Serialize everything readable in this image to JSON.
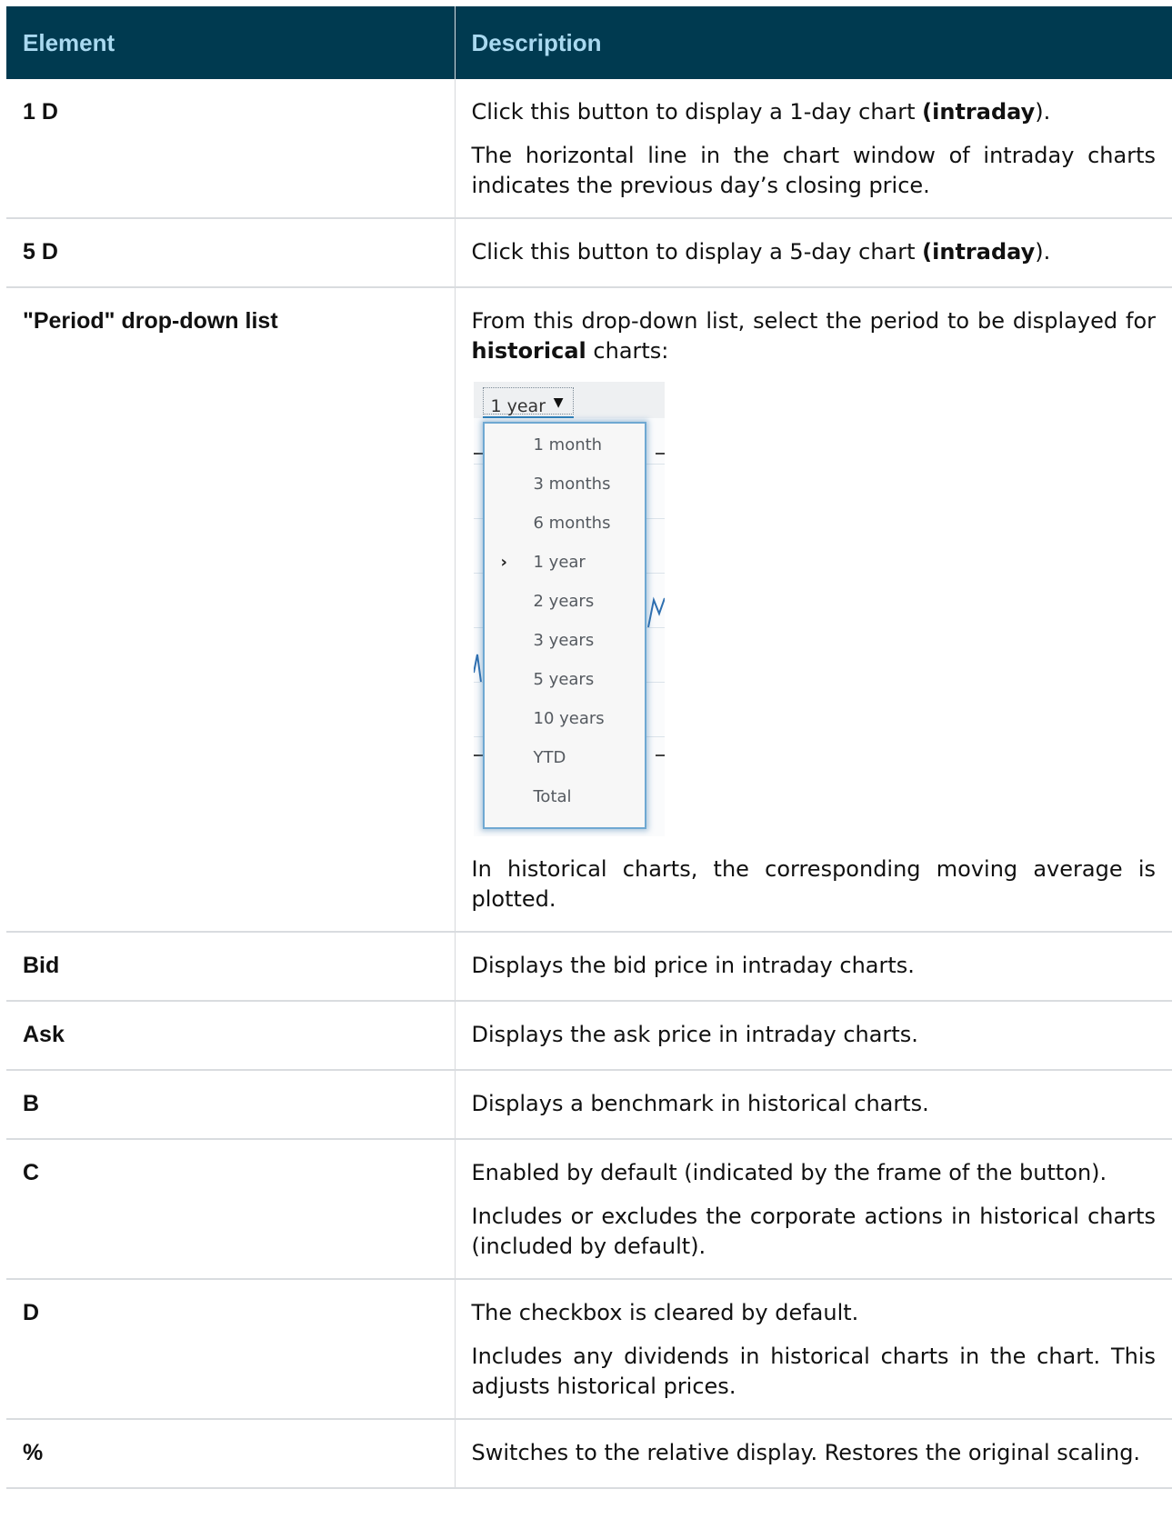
{
  "table": {
    "headers": {
      "element": "Element",
      "description": "Description"
    },
    "rows": {
      "r1d": {
        "element": "1 D",
        "p1_a": "Click this button to display a 1-day chart ",
        "p1_b": "(intraday",
        "p1_c": ").",
        "p2": "The horizontal line in the chart window of intraday charts indicates the previous day’s closing price."
      },
      "r5d": {
        "element": "5 D",
        "p1_a": "Click this button to display a 5-day chart ",
        "p1_b": "(intraday",
        "p1_c": ")."
      },
      "period": {
        "element": "\"Period\" drop-down list",
        "p1_a": "From this drop-down list, select the period to be displayed for ",
        "p1_b": "historical",
        "p1_c": " charts:",
        "p2": "In historical charts, the corresponding moving average is plotted.",
        "dropdown": {
          "selected": "1 year",
          "caret_icon": "triangle-down-icon",
          "options": [
            "1 month",
            "3 months",
            "6 months",
            "1 year",
            "2 years",
            "3 years",
            "5 years",
            "10 years",
            "YTD",
            "Total"
          ],
          "selected_index": 3,
          "marker_icon": "chevron-right-icon",
          "accent": "#6fa8d2"
        }
      },
      "bid": {
        "element": "Bid",
        "p1": "Displays the bid price in intraday charts."
      },
      "ask": {
        "element": "Ask",
        "p1": "Displays the ask price in intraday charts."
      },
      "b": {
        "element": "B",
        "p1": "Displays a benchmark in historical charts."
      },
      "c": {
        "element": "C",
        "p1": "Enabled by default (indicated by the frame of the button).",
        "p2": "Includes or excludes the corporate actions in historical charts (included by default)."
      },
      "d": {
        "element": "D",
        "p1": "The checkbox is cleared by default.",
        "p2": "Includes any dividends in historical charts in the chart. This adjusts historical prices."
      },
      "pct": {
        "element": "%",
        "p1": "Switches to the relative display. Restores the original scaling."
      }
    }
  },
  "colors": {
    "header_bg": "#003a50",
    "header_text": "#a9d9f0",
    "row_border": "#d9dcdf"
  }
}
